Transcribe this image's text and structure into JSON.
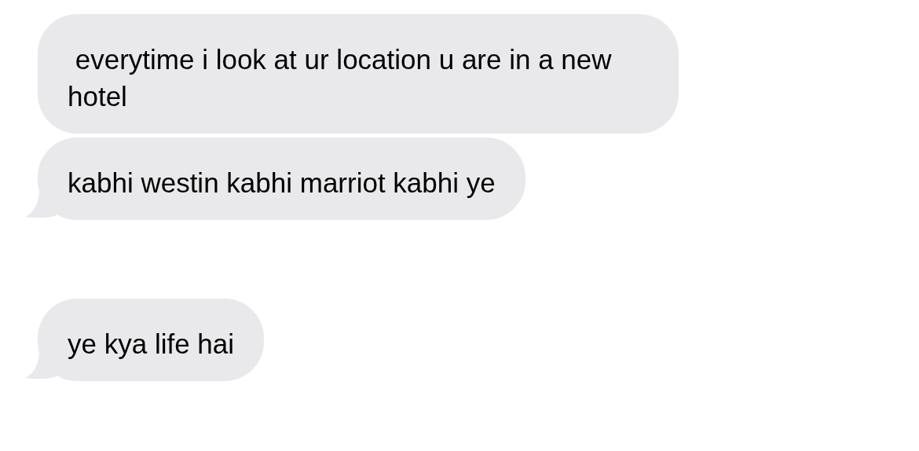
{
  "groups": [
    {
      "messages": [
        {
          "text": " everytime i look at ur location u are in a new hotel",
          "tail": false
        },
        {
          "text": "kabhi westin kabhi marriot kabhi ye",
          "tail": true
        }
      ]
    },
    {
      "messages": [
        {
          "text": "ye kya life hai",
          "tail": true
        }
      ]
    }
  ]
}
